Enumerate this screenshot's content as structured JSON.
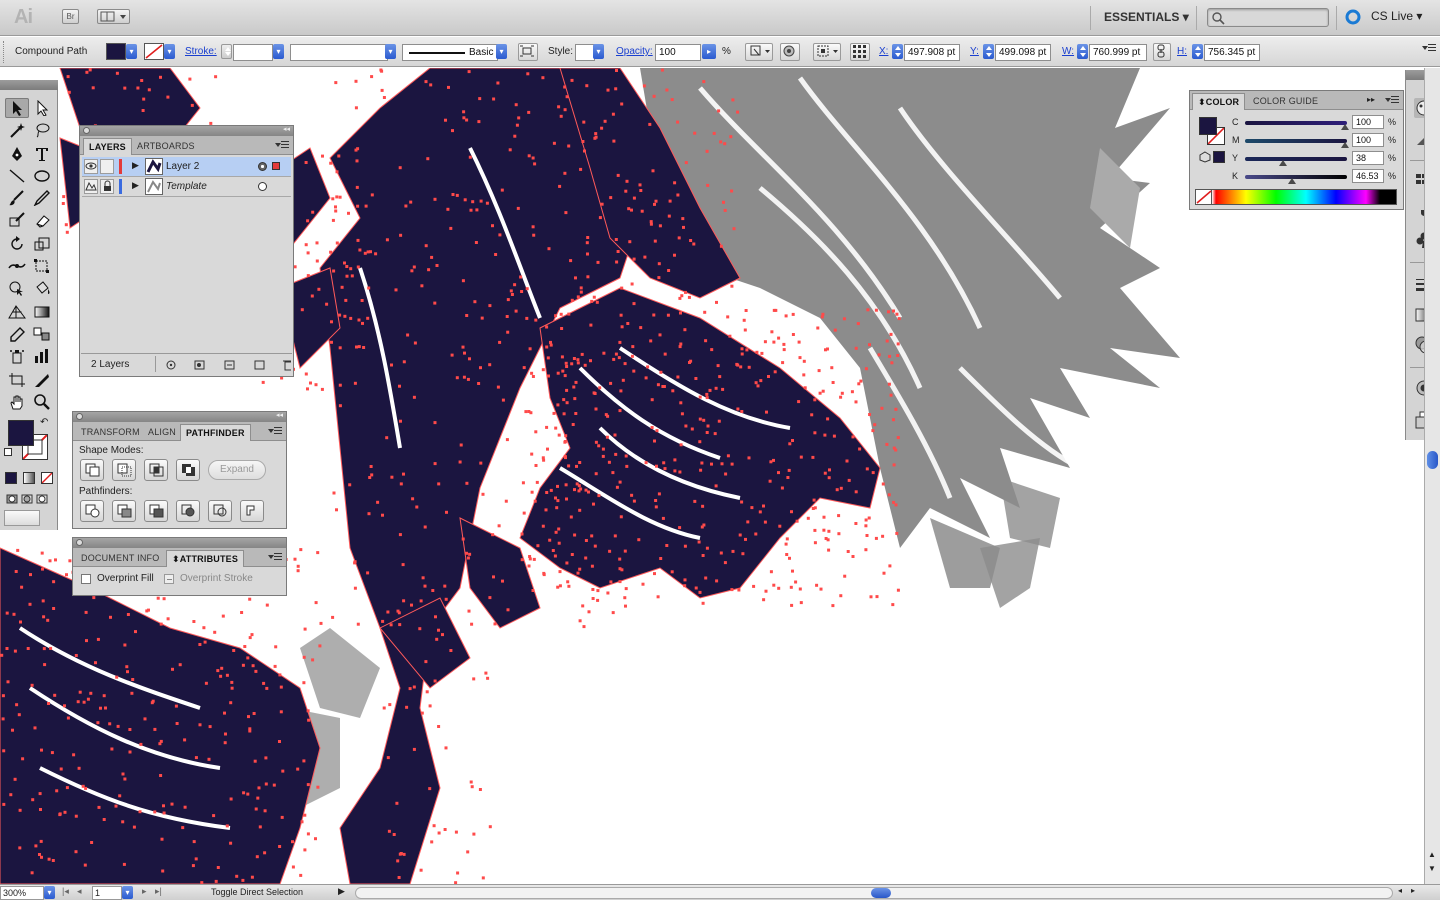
{
  "app": {
    "logo": "Ai",
    "bridge": "Br",
    "workspace": "ESSENTIALS",
    "search_placeholder": "",
    "cs_live": "CS Live"
  },
  "control": {
    "selection_type": "Compound Path",
    "stroke_label": "Stroke:",
    "stroke_weight": "",
    "brush_style": "Basic",
    "style_label": "Style:",
    "opacity_label": "Opacity:",
    "opacity_value": "100",
    "opacity_unit": "%",
    "x_label": "X:",
    "x_value": "497.908 pt",
    "y_label": "Y:",
    "y_value": "499.098 pt",
    "w_label": "W:",
    "w_value": "760.999 pt",
    "h_label": "H:",
    "h_value": "756.345 pt",
    "fill_color": "#1b1540"
  },
  "layers_panel": {
    "tabs": [
      "LAYERS",
      "ARTBOARDS"
    ],
    "layers": [
      {
        "name": "Layer 2",
        "color": "#e33b3b",
        "selected": true
      },
      {
        "name": "Template",
        "color": "#3a6be0",
        "selected": false
      }
    ],
    "footer": "2 Layers"
  },
  "transform_panel": {
    "tabs": [
      "TRANSFORM",
      "ALIGN",
      "PATHFINDER"
    ],
    "shape_modes_label": "Shape Modes:",
    "expand_label": "Expand",
    "pathfinders_label": "Pathfinders:"
  },
  "attributes_panel": {
    "tabs": [
      "DOCUMENT INFO",
      "ATTRIBUTES"
    ],
    "overprint_fill": "Overprint Fill",
    "overprint_stroke": "Overprint Stroke"
  },
  "color_panel": {
    "tabs": [
      "COLOR",
      "COLOR GUIDE"
    ],
    "channels": [
      {
        "label": "C",
        "value": "100",
        "level": 1.0
      },
      {
        "label": "M",
        "value": "100",
        "level": 1.0
      },
      {
        "label": "Y",
        "value": "38",
        "level": 0.38
      },
      {
        "label": "K",
        "value": "46.53",
        "level": 0.4653
      }
    ],
    "unit": "%"
  },
  "status": {
    "zoom": "300%",
    "artboard": "1",
    "tool_tip": "Toggle Direct Selection"
  },
  "colors": {
    "ink": "#1b1540",
    "anchor": "#ff4a4a",
    "gray_art": "#8c8c8c"
  }
}
